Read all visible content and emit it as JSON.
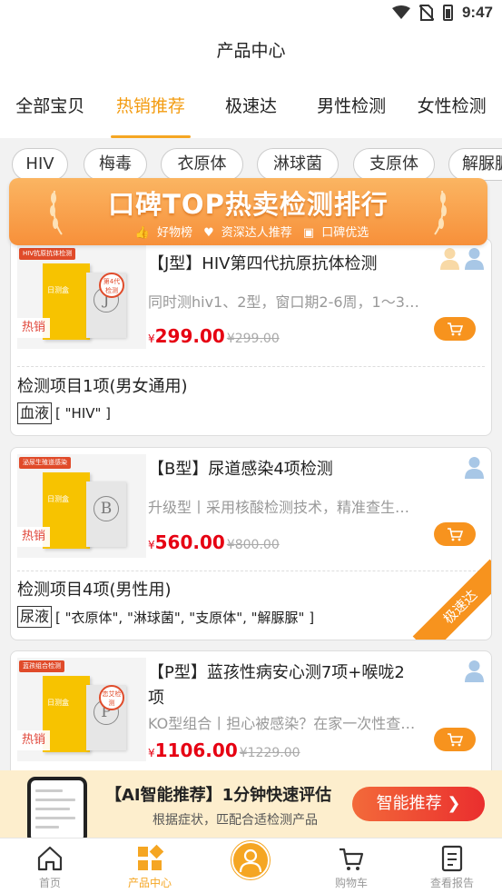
{
  "status": {
    "time": "9:47"
  },
  "header": {
    "title": "产品中心"
  },
  "categories": [
    "全部宝贝",
    "热销推荐",
    "极速达",
    "男性检测",
    "女性检测"
  ],
  "active_category": "热销推荐",
  "chips": [
    "HIV",
    "梅毒",
    "衣原体",
    "淋球菌",
    "支原体",
    "解脲脲"
  ],
  "banner": {
    "title": "口碑TOP热卖检测排行",
    "subs": [
      "好物榜",
      "资深达人推荐",
      "口碑优选"
    ]
  },
  "products": [
    {
      "title": "【J型】HIV第四代抗原抗体检测",
      "desc": "同时测hiv1、2型，窗口期2-6周，1～3…",
      "price_symbol": "¥",
      "price": "299.00",
      "orig_price": "¥299.00",
      "hot": "热销",
      "img_tag": "HIV抗原抗体检测",
      "box_text": "日测盒",
      "box_letter": "J",
      "stamp": "第4代检测",
      "items_title": "检测项目1项(男女通用)",
      "sample": "血液",
      "items": "[ \"HIV\" ]"
    },
    {
      "title": "【B型】尿道感染4项检测",
      "desc": "升级型丨采用核酸检测技术，精准查生…",
      "price_symbol": "¥",
      "price": "560.00",
      "orig_price": "¥800.00",
      "hot": "热销",
      "img_tag": "泌尿生殖道感染",
      "box_text": "日测盒",
      "box_letter": "B",
      "items_title": "检测项目4项(男性用)",
      "sample": "尿液",
      "items": "[ \"衣原体\", \"淋球菌\", \"支原体\", \"解脲脲\" ]",
      "ribbon": "极速达"
    },
    {
      "title": "【P型】蓝孩性病安心测7项+喉咙2项",
      "desc": "KO型组合丨担心被感染？在家一次性查…",
      "price_symbol": "¥",
      "price": "1106.00",
      "orig_price": "¥1229.00",
      "hot": "热销",
      "img_tag": "蓝孩组合检测",
      "box_text": "日测盒",
      "box_letter": "P",
      "stamp": "恋艾检测"
    }
  ],
  "ai_banner": {
    "title": "【AI智能推荐】1分钟快速评估",
    "subtitle": "根据症状，匹配合适检测产品",
    "button": "智能推荐"
  },
  "tabbar": [
    {
      "label": "首页",
      "icon": "home-icon"
    },
    {
      "label": "产品中心",
      "icon": "grid-icon",
      "active": true
    },
    {
      "label": "",
      "icon": "doctor-icon"
    },
    {
      "label": "购物车",
      "icon": "cart-icon"
    },
    {
      "label": "查看报告",
      "icon": "report-icon"
    }
  ],
  "colors": {
    "accent": "#f5a623",
    "price": "#e60012",
    "button": "#f7931e"
  }
}
